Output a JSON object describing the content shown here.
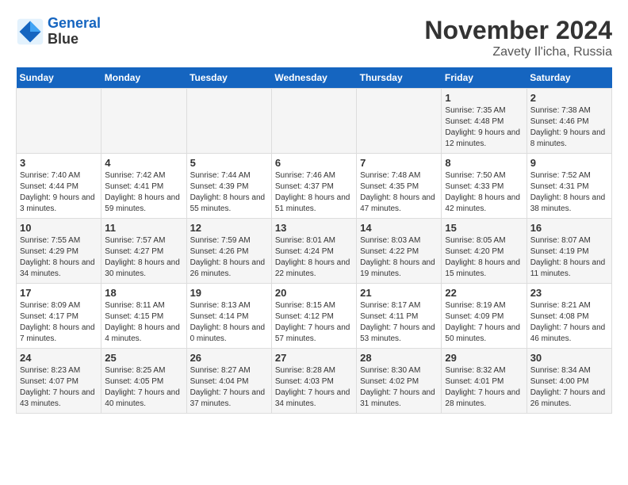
{
  "header": {
    "logo_line1": "General",
    "logo_line2": "Blue",
    "title": "November 2024",
    "subtitle": "Zavety Il'icha, Russia"
  },
  "days_of_week": [
    "Sunday",
    "Monday",
    "Tuesday",
    "Wednesday",
    "Thursday",
    "Friday",
    "Saturday"
  ],
  "weeks": [
    [
      {
        "day": "",
        "info": ""
      },
      {
        "day": "",
        "info": ""
      },
      {
        "day": "",
        "info": ""
      },
      {
        "day": "",
        "info": ""
      },
      {
        "day": "",
        "info": ""
      },
      {
        "day": "1",
        "info": "Sunrise: 7:35 AM\nSunset: 4:48 PM\nDaylight: 9 hours and 12 minutes."
      },
      {
        "day": "2",
        "info": "Sunrise: 7:38 AM\nSunset: 4:46 PM\nDaylight: 9 hours and 8 minutes."
      }
    ],
    [
      {
        "day": "3",
        "info": "Sunrise: 7:40 AM\nSunset: 4:44 PM\nDaylight: 9 hours and 3 minutes."
      },
      {
        "day": "4",
        "info": "Sunrise: 7:42 AM\nSunset: 4:41 PM\nDaylight: 8 hours and 59 minutes."
      },
      {
        "day": "5",
        "info": "Sunrise: 7:44 AM\nSunset: 4:39 PM\nDaylight: 8 hours and 55 minutes."
      },
      {
        "day": "6",
        "info": "Sunrise: 7:46 AM\nSunset: 4:37 PM\nDaylight: 8 hours and 51 minutes."
      },
      {
        "day": "7",
        "info": "Sunrise: 7:48 AM\nSunset: 4:35 PM\nDaylight: 8 hours and 47 minutes."
      },
      {
        "day": "8",
        "info": "Sunrise: 7:50 AM\nSunset: 4:33 PM\nDaylight: 8 hours and 42 minutes."
      },
      {
        "day": "9",
        "info": "Sunrise: 7:52 AM\nSunset: 4:31 PM\nDaylight: 8 hours and 38 minutes."
      }
    ],
    [
      {
        "day": "10",
        "info": "Sunrise: 7:55 AM\nSunset: 4:29 PM\nDaylight: 8 hours and 34 minutes."
      },
      {
        "day": "11",
        "info": "Sunrise: 7:57 AM\nSunset: 4:27 PM\nDaylight: 8 hours and 30 minutes."
      },
      {
        "day": "12",
        "info": "Sunrise: 7:59 AM\nSunset: 4:26 PM\nDaylight: 8 hours and 26 minutes."
      },
      {
        "day": "13",
        "info": "Sunrise: 8:01 AM\nSunset: 4:24 PM\nDaylight: 8 hours and 22 minutes."
      },
      {
        "day": "14",
        "info": "Sunrise: 8:03 AM\nSunset: 4:22 PM\nDaylight: 8 hours and 19 minutes."
      },
      {
        "day": "15",
        "info": "Sunrise: 8:05 AM\nSunset: 4:20 PM\nDaylight: 8 hours and 15 minutes."
      },
      {
        "day": "16",
        "info": "Sunrise: 8:07 AM\nSunset: 4:19 PM\nDaylight: 8 hours and 11 minutes."
      }
    ],
    [
      {
        "day": "17",
        "info": "Sunrise: 8:09 AM\nSunset: 4:17 PM\nDaylight: 8 hours and 7 minutes."
      },
      {
        "day": "18",
        "info": "Sunrise: 8:11 AM\nSunset: 4:15 PM\nDaylight: 8 hours and 4 minutes."
      },
      {
        "day": "19",
        "info": "Sunrise: 8:13 AM\nSunset: 4:14 PM\nDaylight: 8 hours and 0 minutes."
      },
      {
        "day": "20",
        "info": "Sunrise: 8:15 AM\nSunset: 4:12 PM\nDaylight: 7 hours and 57 minutes."
      },
      {
        "day": "21",
        "info": "Sunrise: 8:17 AM\nSunset: 4:11 PM\nDaylight: 7 hours and 53 minutes."
      },
      {
        "day": "22",
        "info": "Sunrise: 8:19 AM\nSunset: 4:09 PM\nDaylight: 7 hours and 50 minutes."
      },
      {
        "day": "23",
        "info": "Sunrise: 8:21 AM\nSunset: 4:08 PM\nDaylight: 7 hours and 46 minutes."
      }
    ],
    [
      {
        "day": "24",
        "info": "Sunrise: 8:23 AM\nSunset: 4:07 PM\nDaylight: 7 hours and 43 minutes."
      },
      {
        "day": "25",
        "info": "Sunrise: 8:25 AM\nSunset: 4:05 PM\nDaylight: 7 hours and 40 minutes."
      },
      {
        "day": "26",
        "info": "Sunrise: 8:27 AM\nSunset: 4:04 PM\nDaylight: 7 hours and 37 minutes."
      },
      {
        "day": "27",
        "info": "Sunrise: 8:28 AM\nSunset: 4:03 PM\nDaylight: 7 hours and 34 minutes."
      },
      {
        "day": "28",
        "info": "Sunrise: 8:30 AM\nSunset: 4:02 PM\nDaylight: 7 hours and 31 minutes."
      },
      {
        "day": "29",
        "info": "Sunrise: 8:32 AM\nSunset: 4:01 PM\nDaylight: 7 hours and 28 minutes."
      },
      {
        "day": "30",
        "info": "Sunrise: 8:34 AM\nSunset: 4:00 PM\nDaylight: 7 hours and 26 minutes."
      }
    ]
  ]
}
